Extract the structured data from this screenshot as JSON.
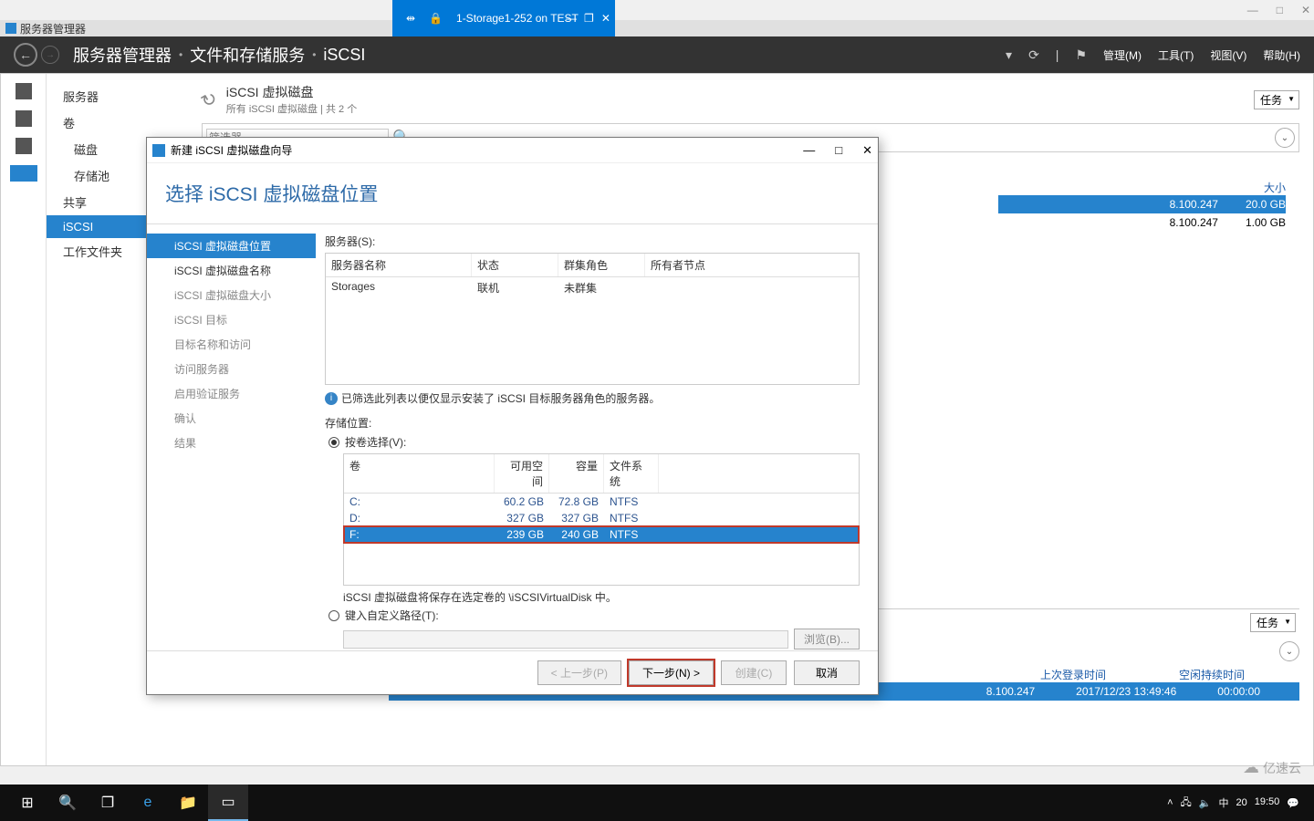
{
  "outer_window": {
    "minimize": "—",
    "maximize": "□",
    "close": "✕"
  },
  "app_titlebar": {
    "name": "服务器管理器"
  },
  "remote_bar": {
    "title": "1-Storage1-252 on TEST",
    "pin": "⇹",
    "lock": "🔒",
    "min": "—",
    "rest": "❐",
    "close": "✕"
  },
  "sm_header": {
    "back": "←",
    "fwd": "→",
    "crumb1": "服务器管理器",
    "crumb2": "文件和存储服务",
    "crumb3": "iSCSI",
    "dropdown": "▾",
    "refresh": "⟳",
    "sep": "|",
    "flag": "⚑",
    "menu_manage": "管理(M)",
    "menu_tools": "工具(T)",
    "menu_view": "视图(V)",
    "menu_help": "帮助(H)"
  },
  "sidebar": {
    "items": [
      "服务器",
      "卷",
      "磁盘",
      "存储池",
      "共享",
      "iSCSI",
      "工作文件夹"
    ]
  },
  "content": {
    "title": "iSCSI 虚拟磁盘",
    "subtitle": "所有 iSCSI 虚拟磁盘 | 共 2 个",
    "tasks": "任务",
    "filter_ph": "筛选器",
    "col_size": "大小",
    "rows": [
      {
        "ip": "8.100.247",
        "size": "20.0 GB"
      },
      {
        "ip": "8.100.247",
        "size": "1.00 GB"
      }
    ],
    "bottom_cols": {
      "c1": "上次登录时间",
      "c2": "空闲持续时间"
    },
    "bottom_row": {
      "ip": "8.100.247",
      "t": "2017/12/23 13:49:46",
      "idle": "00:00:00"
    }
  },
  "wizard": {
    "title": "新建 iSCSI 虚拟磁盘向导",
    "heading": "选择 iSCSI 虚拟磁盘位置",
    "steps": [
      "iSCSI 虚拟磁盘位置",
      "iSCSI 虚拟磁盘名称",
      "iSCSI 虚拟磁盘大小",
      "iSCSI 目标",
      "目标名称和访问",
      "访问服务器",
      "启用验证服务",
      "确认",
      "结果"
    ],
    "servers_label": "服务器(S):",
    "srv_cols": {
      "c1": "服务器名称",
      "c2": "状态",
      "c3": "群集角色",
      "c4": "所有者节点"
    },
    "srv_row": {
      "name": "Storages",
      "status": "联机",
      "cluster": "未群集",
      "owner": ""
    },
    "info": "已筛选此列表以便仅显示安装了 iSCSI 目标服务器角色的服务器。",
    "storage_label": "存储位置:",
    "radio_vol": "按卷选择(V):",
    "vol_cols": {
      "c1": "卷",
      "c2": "可用空间",
      "c3": "容量",
      "c4": "文件系统"
    },
    "vol_rows": [
      {
        "v": "C:",
        "free": "60.2 GB",
        "cap": "72.8 GB",
        "fs": "NTFS"
      },
      {
        "v": "D:",
        "free": "327 GB",
        "cap": "327 GB",
        "fs": "NTFS"
      },
      {
        "v": "F:",
        "free": "239 GB",
        "cap": "240 GB",
        "fs": "NTFS"
      }
    ],
    "vol_note": "iSCSI 虚拟磁盘将保存在选定卷的 \\iSCSIVirtualDisk 中。",
    "radio_path": "键入自定义路径(T):",
    "browse": "浏览(B)...",
    "btn_prev": "< 上一步(P)",
    "btn_next": "下一步(N) >",
    "btn_create": "创建(C)",
    "btn_cancel": "取消",
    "win_min": "—",
    "win_max": "□",
    "win_close": "✕"
  },
  "taskbar": {
    "start": "⊞",
    "search": "🔍",
    "taskview": "❐",
    "ie": "e",
    "explorer": "📁",
    "sm": "▭",
    "tray_up": "˄",
    "net": "🖧",
    "vol": "🔈",
    "ime": "中",
    "t1": "19:50",
    "t2": "20",
    "notif": "💬"
  },
  "watermark": "亿速云"
}
